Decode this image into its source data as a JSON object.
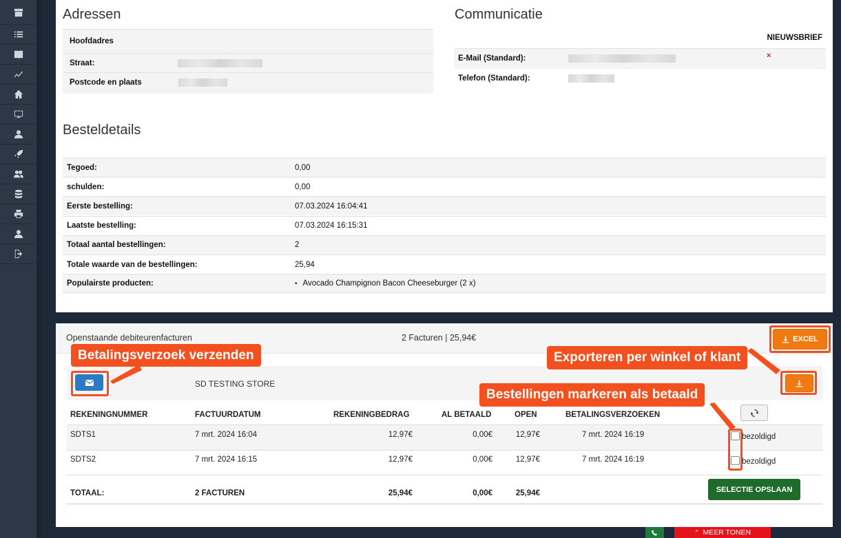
{
  "sidebar": {
    "items": [
      {
        "icon": "archive-icon"
      },
      {
        "icon": "list-icon"
      },
      {
        "icon": "book-icon"
      },
      {
        "icon": "chart-icon"
      },
      {
        "icon": "home-icon"
      },
      {
        "icon": "monitor-icon"
      },
      {
        "icon": "user-icon"
      },
      {
        "icon": "rocket-icon"
      },
      {
        "icon": "users-icon"
      },
      {
        "icon": "database-icon"
      },
      {
        "icon": "printer-icon"
      },
      {
        "icon": "user-icon"
      },
      {
        "icon": "logout-icon"
      }
    ]
  },
  "addresses": {
    "title": "Adressen",
    "main_label": "Hoofdadres",
    "street_label": "Straat:",
    "postcode_label": "Postcode en plaats"
  },
  "communication": {
    "title": "Communicatie",
    "newsletter_header": "NIEUWSBRIEF",
    "email_label": "E-Mail (Standard):",
    "email_newsletter": "×",
    "phone_label": "Telefon (Standard):"
  },
  "order_details": {
    "title": "Besteldetails",
    "rows": [
      {
        "label": "Tegoed:",
        "value": "0,00"
      },
      {
        "label": "schulden:",
        "value": "0,00"
      },
      {
        "label": "Eerste bestelling:",
        "value": "07.03.2024 16:04:41"
      },
      {
        "label": "Laatste bestelling:",
        "value": "07.03.2024 16:15:31"
      },
      {
        "label": "Totaal aantal bestellingen:",
        "value": "2"
      },
      {
        "label": "Totale waarde van de bestellingen:",
        "value": "25,94"
      },
      {
        "label": "Populairste producten:",
        "value": "Avocado Champignon Bacon Cheeseburger (2 x)"
      }
    ]
  },
  "invoices": {
    "title": "Openstaande debiteurenfacturen",
    "summary": "2 Facturen | 25,94€",
    "excel_label": "EXCEL",
    "store_name": "SD TESTING STORE",
    "columns": [
      "REKENINGNUMMER",
      "FACTUURDATUM",
      "REKENINGBEDRAG",
      "AL BETAALD",
      "OPEN",
      "BETALINGSVERZOEKEN"
    ],
    "rows": [
      {
        "number": "SDTS1",
        "date": "7 mrt. 2024 16:04",
        "amount": "12,97€",
        "paid": "0,00€",
        "open": "12,97€",
        "request": "7 mrt. 2024 16:19",
        "checkbox_label": "bezoldigd"
      },
      {
        "number": "SDTS2",
        "date": "7 mrt. 2024 16:15",
        "amount": "12,97€",
        "paid": "0,00€",
        "open": "12,97€",
        "request": "7 mrt. 2024 16:19",
        "checkbox_label": "bezoldigd"
      }
    ],
    "total": {
      "label": "TOTAAL:",
      "count": "2 FACTUREN",
      "amount": "25,94€",
      "paid": "0,00€",
      "open": "25,94€"
    },
    "save_label": "SELECTIE OPSLAAN"
  },
  "callouts": {
    "send_request": "Betalingsverzoek verzenden",
    "export": "Exporteren per winkel of klant",
    "mark_paid": "Bestellingen markeren als betaald"
  },
  "footer": {
    "more_label": "MEER TONEN"
  },
  "colors": {
    "accent": "#f07a12",
    "callout": "#f2501e",
    "save_green": "#1e6b2c",
    "mail_blue": "#2b7bc2",
    "more_red": "#e3121b"
  }
}
